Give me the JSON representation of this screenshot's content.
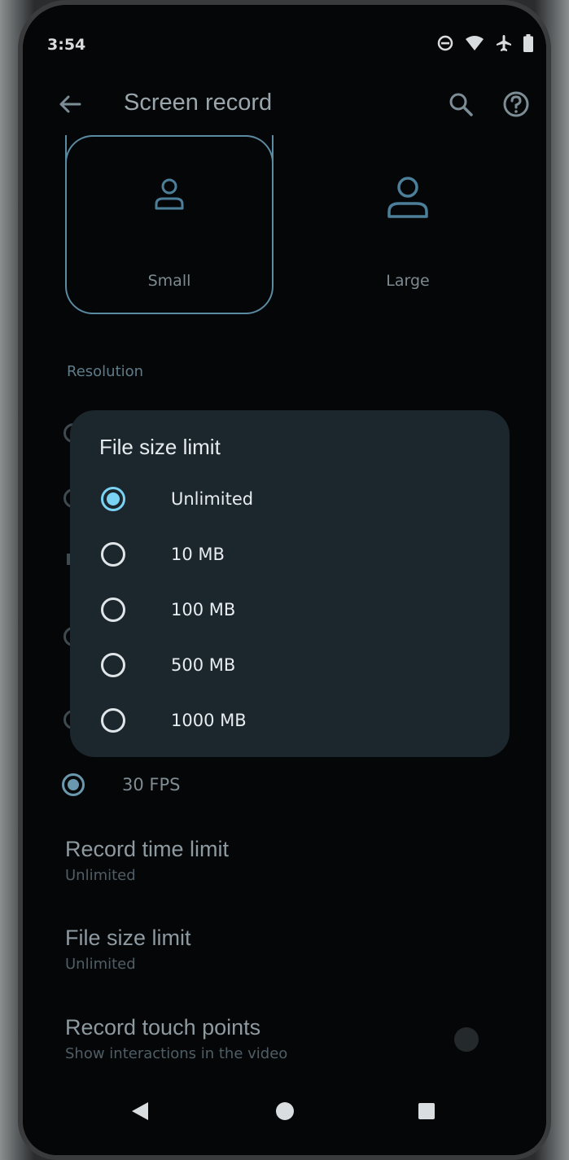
{
  "status_bar": {
    "time": "3:54",
    "icons": [
      "do-not-disturb-icon",
      "wifi-icon",
      "airplane-icon",
      "battery-icon"
    ]
  },
  "app_bar": {
    "title": "Screen record",
    "back_icon": "arrow-back-icon",
    "search_icon": "search-icon",
    "help_icon": "help-icon"
  },
  "touch_size": {
    "options": [
      {
        "label": "Small",
        "selected": true
      },
      {
        "label": "Large",
        "selected": false
      }
    ]
  },
  "resolution": {
    "label": "Resolution"
  },
  "frame_rate": {
    "selected_label": "30 FPS"
  },
  "settings": [
    {
      "title": "Record time limit",
      "subtitle": "Unlimited"
    },
    {
      "title": "File size limit",
      "subtitle": "Unlimited"
    },
    {
      "title": "Record touch points",
      "subtitle": "Show interactions in the video",
      "toggle_on": false
    }
  ],
  "dialog": {
    "title": "File size limit",
    "options": [
      {
        "label": "Unlimited",
        "checked": true
      },
      {
        "label": "10 MB",
        "checked": false
      },
      {
        "label": "100 MB",
        "checked": false
      },
      {
        "label": "500 MB",
        "checked": false
      },
      {
        "label": "1000 MB",
        "checked": false
      }
    ]
  },
  "nav_bar": {
    "icons": [
      "nav-back-icon",
      "nav-home-icon",
      "nav-recents-icon"
    ]
  },
  "colors": {
    "accent": "#7ad3f2",
    "dialog_bg": "#1c262d",
    "screen_bg": "#050607"
  }
}
